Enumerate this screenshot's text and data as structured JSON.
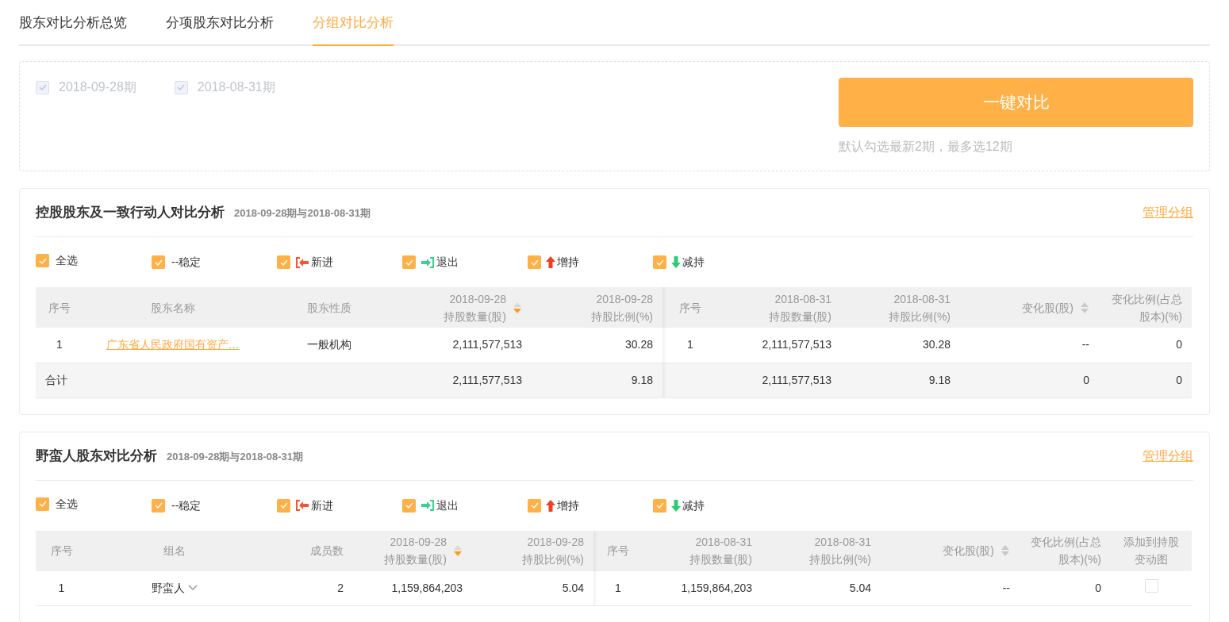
{
  "tabs": [
    {
      "label": "股东对比分析总览",
      "selected": false
    },
    {
      "label": "分项股东对比分析",
      "selected": false
    },
    {
      "label": "分组对比分析",
      "selected": true
    }
  ],
  "periods": {
    "options": [
      {
        "label": "2018-09-28期",
        "checked": true,
        "disabled": true
      },
      {
        "label": "2018-08-31期",
        "checked": true,
        "disabled": true
      }
    ],
    "button": "一键对比",
    "hint": "默认勾选最新2期，最多选12期"
  },
  "sections": [
    {
      "title": "控股股东及一致行动人对比分析",
      "subtitle": "2018-09-28期与2018-08-31期",
      "manage_link": "管理分组",
      "filters": [
        {
          "label": "全选",
          "checked": true,
          "kind": "all"
        },
        {
          "label": "--稳定",
          "checked": true,
          "kind": "stable"
        },
        {
          "label": "新进",
          "checked": true,
          "kind": "new"
        },
        {
          "label": "退出",
          "checked": true,
          "kind": "exit"
        },
        {
          "label": "增持",
          "checked": true,
          "kind": "increase"
        },
        {
          "label": "减持",
          "checked": true,
          "kind": "decrease"
        }
      ],
      "columns": [
        {
          "label": "序号",
          "sortable": false
        },
        {
          "label": "股东名称",
          "sortable": false
        },
        {
          "label": "股东性质",
          "sortable": false
        },
        {
          "label": "2018-09-28\n持股数量(股)",
          "sortable": true,
          "sorted": true
        },
        {
          "label": "2018-09-28\n持股比例(%)",
          "sortable": false
        },
        {
          "label": "序号",
          "sortable": false
        },
        {
          "label": "2018-08-31\n持股数量(股)",
          "sortable": false
        },
        {
          "label": "2018-08-31\n持股比例(%)",
          "sortable": false
        },
        {
          "label": "变化股(股)",
          "sortable": true,
          "sorted": false
        },
        {
          "label": "变化比例(占总股本)(%)",
          "sortable": false
        }
      ],
      "rows": [
        {
          "kind": "data",
          "cells": [
            "1",
            {
              "kind": "link",
              "text": "广东省人民政府国有资产…"
            },
            "一般机构",
            "2,111,577,513",
            "30.28",
            "1",
            "2,111,577,513",
            "30.28",
            "--",
            "0"
          ]
        },
        {
          "kind": "total",
          "cells": [
            "合计",
            "",
            "",
            "2,111,577,513",
            "9.18",
            "",
            "2,111,577,513",
            "9.18",
            "0",
            "0"
          ]
        }
      ]
    },
    {
      "title": "野蛮人股东对比分析",
      "subtitle": "2018-09-28期与2018-08-31期",
      "manage_link": "管理分组",
      "filters": [
        {
          "label": "全选",
          "checked": true,
          "kind": "all"
        },
        {
          "label": "--稳定",
          "checked": true,
          "kind": "stable"
        },
        {
          "label": "新进",
          "checked": true,
          "kind": "new"
        },
        {
          "label": "退出",
          "checked": true,
          "kind": "exit"
        },
        {
          "label": "增持",
          "checked": true,
          "kind": "increase"
        },
        {
          "label": "减持",
          "checked": true,
          "kind": "decrease"
        }
      ],
      "columns": [
        {
          "label": "序号",
          "sortable": false
        },
        {
          "label": "组名",
          "sortable": false
        },
        {
          "label": "成员数",
          "sortable": false
        },
        {
          "label": "2018-09-28\n持股数量(股)",
          "sortable": true,
          "sorted": true
        },
        {
          "label": "2018-09-28\n持股比例(%)",
          "sortable": false
        },
        {
          "label": "序号",
          "sortable": false
        },
        {
          "label": "2018-08-31\n持股数量(股)",
          "sortable": false
        },
        {
          "label": "2018-08-31\n持股比例(%)",
          "sortable": false
        },
        {
          "label": "变化股(股)",
          "sortable": true,
          "sorted": false
        },
        {
          "label": "变化比例(占总股本)(%)",
          "sortable": false
        },
        {
          "label": "添加到持股变动图",
          "sortable": false
        }
      ],
      "rows": [
        {
          "kind": "data",
          "cells": [
            "1",
            {
              "kind": "dropdown",
              "text": "野蛮人"
            },
            "2",
            "1,159,864,203",
            "5.04",
            "1",
            "1,159,864,203",
            "5.04",
            "--",
            "0",
            {
              "kind": "checkbox",
              "checked": false
            }
          ]
        }
      ]
    }
  ]
}
